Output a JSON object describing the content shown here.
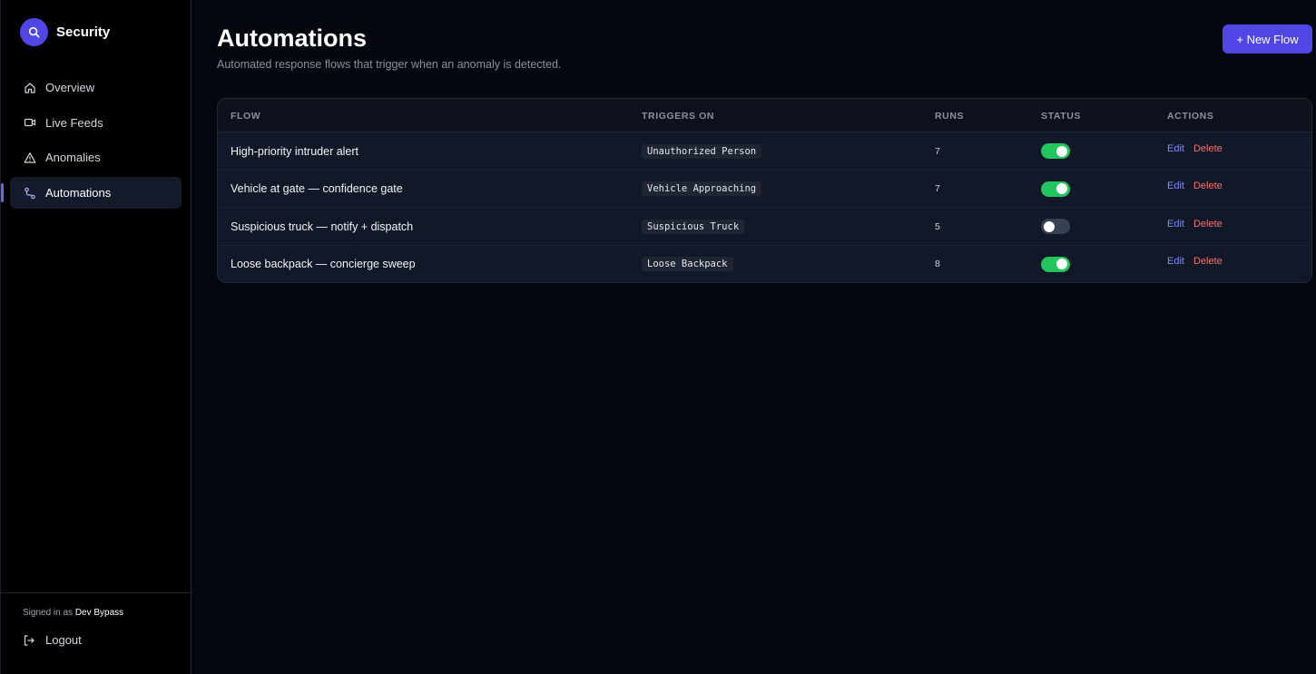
{
  "app": {
    "title": "Security"
  },
  "sidebar": {
    "items": [
      {
        "label": "Overview",
        "icon": "home-icon",
        "active": false
      },
      {
        "label": "Live Feeds",
        "icon": "video-icon",
        "active": false
      },
      {
        "label": "Anomalies",
        "icon": "warning-icon",
        "active": false
      },
      {
        "label": "Automations",
        "icon": "workflow-icon",
        "active": true
      }
    ],
    "signed_in_prefix": "Signed in as",
    "user": "Dev Bypass",
    "logout_label": "Logout"
  },
  "main": {
    "title": "Automations",
    "subtitle": "Automated response flows that trigger when an anomaly is detected.",
    "new_flow_label": "+ New Flow"
  },
  "table": {
    "headers": {
      "flow": "FLOW",
      "triggers": "TRIGGERS ON",
      "runs": "RUNS",
      "status": "STATUS",
      "actions": "ACTIONS"
    },
    "rows": [
      {
        "name": "High-priority intruder alert",
        "trigger": "Unauthorized Person",
        "runs": "7",
        "enabled": true,
        "edit": "Edit",
        "delete": "Delete"
      },
      {
        "name": "Vehicle at gate — confidence gate",
        "trigger": "Vehicle Approaching",
        "runs": "7",
        "enabled": true,
        "edit": "Edit",
        "delete": "Delete"
      },
      {
        "name": "Suspicious truck — notify + dispatch",
        "trigger": "Suspicious Truck",
        "runs": "5",
        "enabled": false,
        "edit": "Edit",
        "delete": "Delete"
      },
      {
        "name": "Loose backpack — concierge sweep",
        "trigger": "Loose Backpack",
        "runs": "8",
        "enabled": true,
        "edit": "Edit",
        "delete": "Delete"
      }
    ]
  },
  "colors": {
    "accent": "#4f46e5",
    "toggle_on": "#22c55e",
    "toggle_off": "#374151",
    "edit": "#818cf8",
    "delete": "#f87171"
  }
}
